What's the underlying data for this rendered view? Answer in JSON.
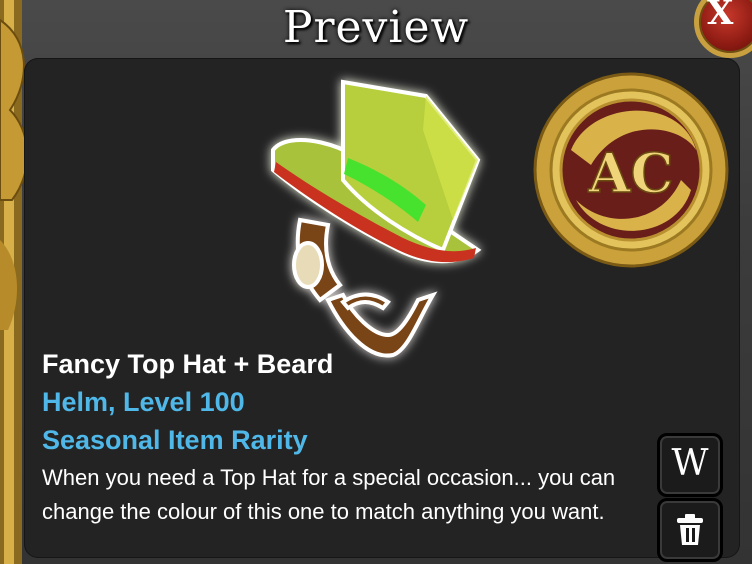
{
  "window": {
    "title": "Preview",
    "close_label": "X"
  },
  "item": {
    "name": "Fancy Top Hat + Beard",
    "type_level": "Helm, Level 100",
    "rarity": "Seasonal Item Rarity",
    "description": "When you need a Top Hat for a special occasion... you can change the colour of this one to match anything you want.",
    "badge_text": "AC",
    "preview_icon": "top-hat-beard"
  },
  "actions": {
    "wear_label": "W",
    "trash_icon": "trash-icon"
  },
  "colors": {
    "name_text": "#ffffff",
    "info_text": "#4fb8e8",
    "panel_bg": "#232323",
    "gold": "#c9a040"
  }
}
